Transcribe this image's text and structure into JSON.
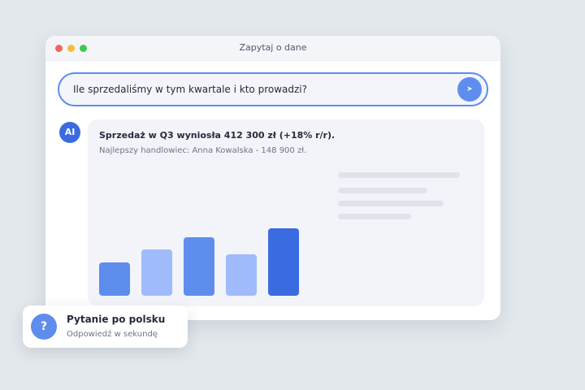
{
  "window": {
    "title": "Zapytaj o dane"
  },
  "search": {
    "query": "Ile sprzedaliśmy w tym kwartale i kto prowadzi?",
    "send_icon": "send-arrow-icon",
    "send_glyph": "➤"
  },
  "answer": {
    "avatar_label": "AI",
    "headline": "Sprzedaż w Q3 wyniosła 412 300 zł (+18% r/r).",
    "detail": "Najlepszy handlowiec: Anna Kowalska - 148 900 zł."
  },
  "chart_data": {
    "type": "bar",
    "values": [
      0.49,
      0.69,
      0.87,
      0.62,
      1.0
    ],
    "colors": [
      "#5e8ded",
      "#a0bbfb",
      "#5e8ded",
      "#a0bbfb",
      "#3a6be0"
    ],
    "ylim": [
      0,
      1
    ],
    "grid": false,
    "legend": false
  },
  "toast": {
    "icon": "question-icon",
    "icon_glyph": "?",
    "title": "Pytanie po polsku",
    "subtitle": "Odpowiedź w sekundę"
  },
  "colors": {
    "accent": "#5e8ded",
    "accent_dark": "#3a6be0",
    "accent_light": "#a0bbfb"
  }
}
